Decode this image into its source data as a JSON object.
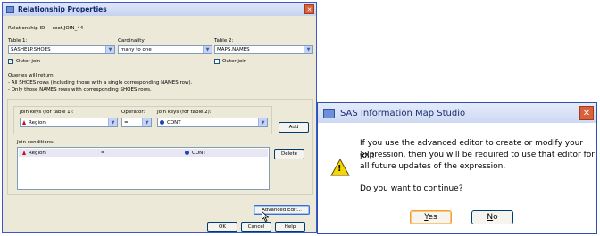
{
  "relationship": {
    "title": "Relationship Properties",
    "id_label": "Relationship ID:",
    "id_value": "root.JOIN_44",
    "table1_label": "Table 1:",
    "table1_value": "SASHELP.SHOES",
    "cardinality_label": "Cardinality",
    "cardinality_value": "many to one",
    "table2_label": "Table 2:",
    "table2_value": "MAPS.NAMES",
    "outer_join_1": "Outer join",
    "outer_join_1_checked": true,
    "outer_join_2": "Outer join",
    "outer_join_2_checked": false,
    "queries_title": "Queries will return:",
    "queries_line1": "- All SHOES rows (including those with a single corresponding NAMES row).",
    "queries_line2": "- Only those NAMES rows with corresponding SHOES rows.",
    "join_keys_1_label": "Join keys (for table 1):",
    "join_keys_1_value": "Region",
    "operator_label": "Operator:",
    "operator_value": "=",
    "join_keys_2_label": "Join keys (for table 2):",
    "join_keys_2_value": "CONT",
    "add_button": "Add",
    "join_conditions_label": "Join conditions:",
    "condition_left": "Region",
    "condition_op": "=",
    "condition_right": "CONT",
    "delete_button": "Delete",
    "advanced_edit_button": "Advanced Edit...",
    "ok_button": "OK",
    "cancel_button": "Cancel",
    "help_button": "Help"
  },
  "sas_dialog": {
    "title": "SAS Information Map Studio",
    "message_line1": "If you use the advanced editor to create or modify your join",
    "message_line2": "expression, then you will be required to use that editor for",
    "message_line3": "all future updates of the expression.",
    "question": "Do you want to continue?",
    "yes_button": "Yes",
    "no_button": "No",
    "close_glyph": "✕",
    "warning_glyph": "!"
  },
  "colors": {
    "titlebar_text": "#10246e",
    "close_button": "#d8613d",
    "warning_fill": "#f5d800",
    "key_table1_icon": "#c0151d",
    "key_table2_icon": "#1f44b8"
  },
  "icons": [
    "window-icon",
    "close-icon",
    "dropdown-arrow-icon",
    "checkbox-icon",
    "key-triangle-icon",
    "key-circle-icon",
    "warning-icon"
  ]
}
